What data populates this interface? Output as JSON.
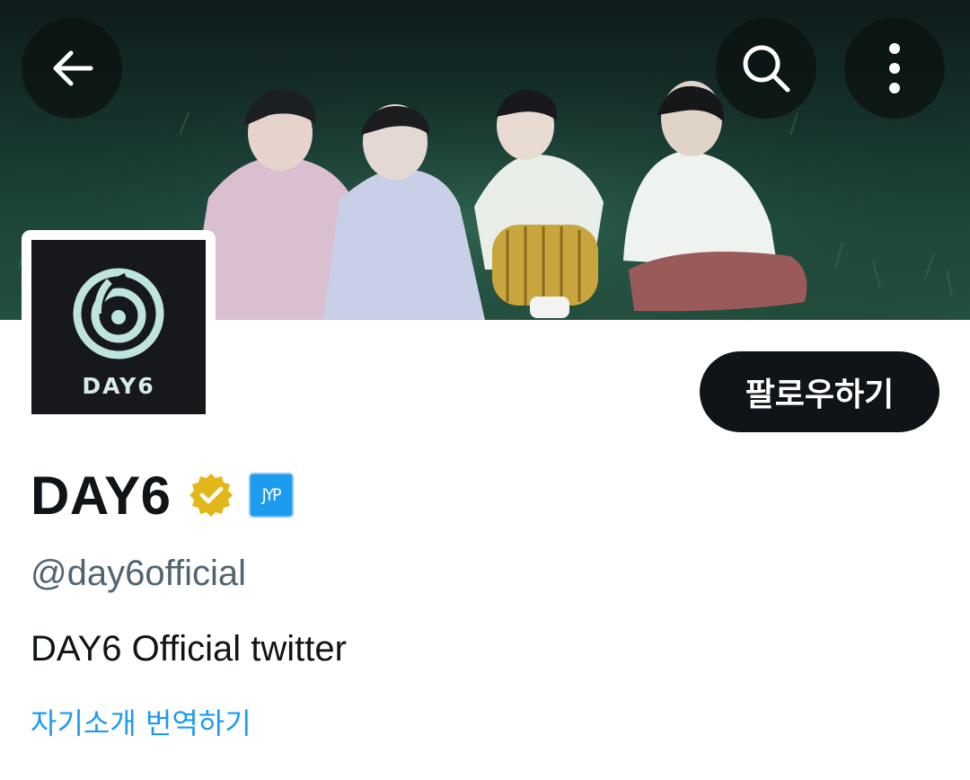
{
  "header": {
    "back_icon": "arrow-left-icon",
    "search_icon": "search-icon",
    "more_icon": "more-vertical-icon"
  },
  "avatar": {
    "logo_text": "DAY6"
  },
  "profile": {
    "display_name": "DAY6",
    "verified_badge": "gold-verified-badge-icon",
    "affiliate_badge_text": "JYP",
    "handle": "@day6official",
    "bio": "DAY6 Official twitter",
    "translate_link": "자기소개 번역하기"
  },
  "actions": {
    "follow_label": "팔로우하기"
  },
  "colors": {
    "primary_text": "#0f1419",
    "secondary_text": "#536471",
    "link": "#1d9bf0",
    "verified_gold": "#e2b719",
    "affiliate_blue": "#1d9bf0",
    "button_bg": "#0f1419"
  }
}
